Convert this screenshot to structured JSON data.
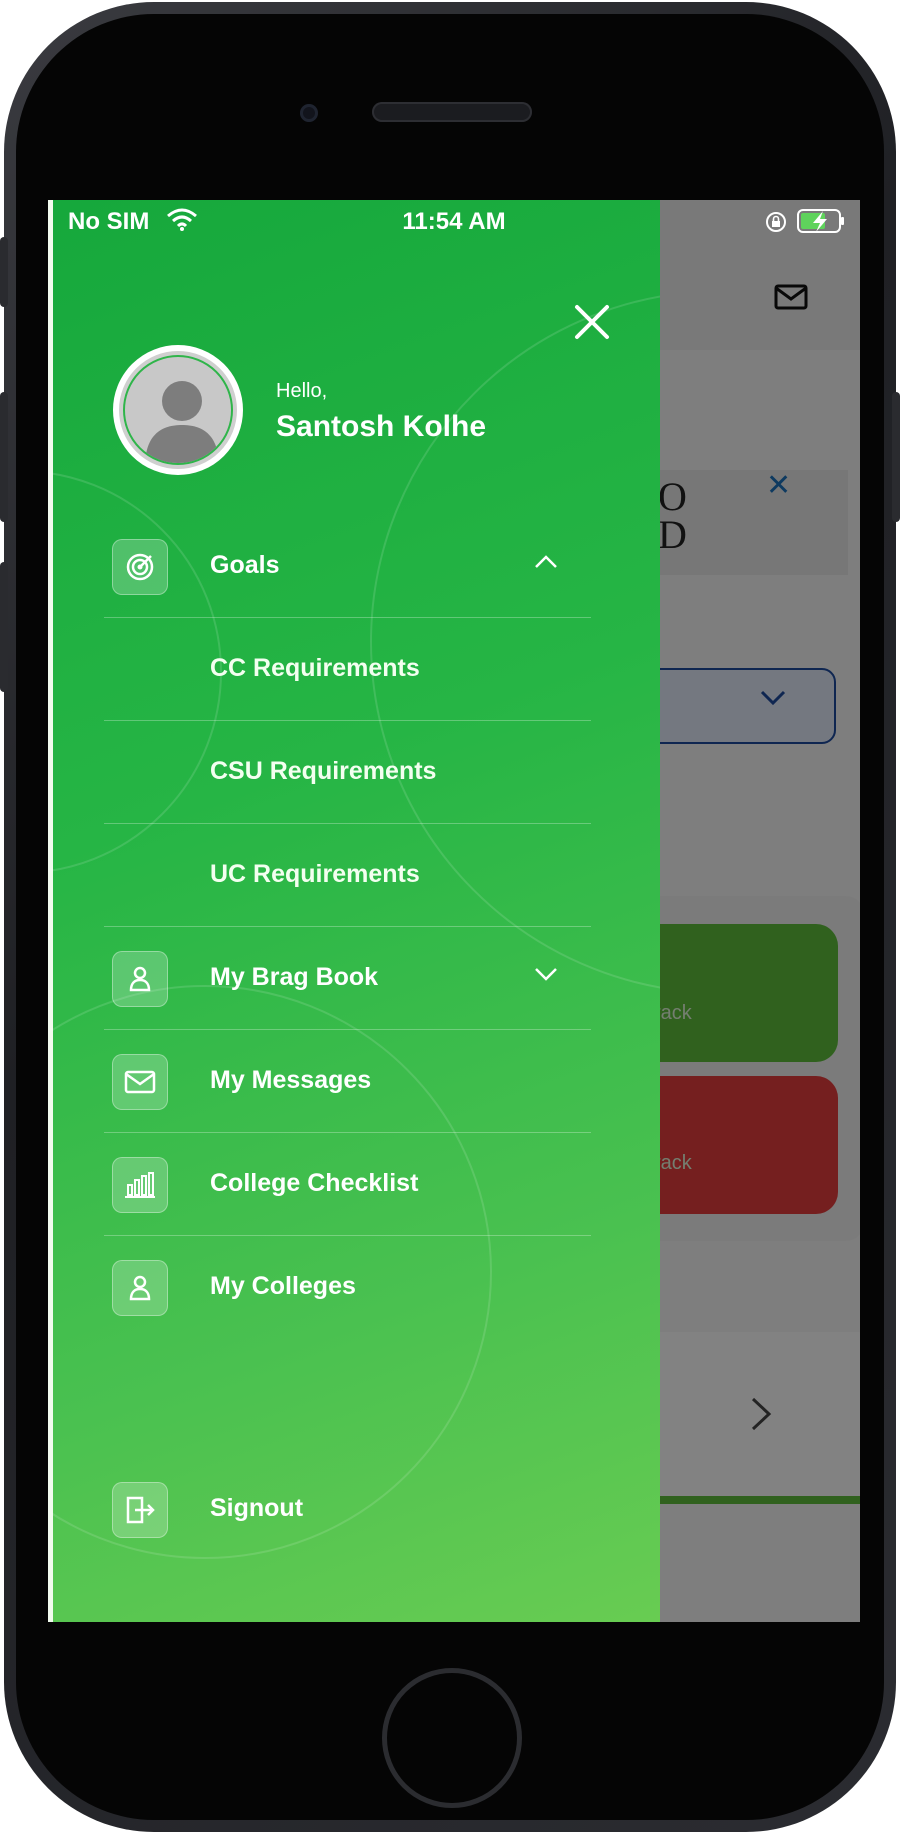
{
  "status_bar": {
    "carrier": "No SIM",
    "time": "11:54 AM"
  },
  "background_app": {
    "track_label_1": "rack",
    "track_label_2": "rack",
    "banner_text": "O\nD"
  },
  "drawer": {
    "greeting": "Hello,",
    "user_name": "Santosh Kolhe",
    "menu": [
      {
        "label": "Goals",
        "icon": "target-icon",
        "expanded": true
      },
      {
        "label": "CC Requirements",
        "submenu": true
      },
      {
        "label": "CSU Requirements",
        "submenu": true
      },
      {
        "label": "UC Requirements",
        "submenu": true
      },
      {
        "label": "My Brag Book",
        "icon": "person-icon",
        "expanded": false
      },
      {
        "label": "My Messages",
        "icon": "mail-icon"
      },
      {
        "label": "College Checklist",
        "icon": "bar-chart-icon"
      },
      {
        "label": "My Colleges",
        "icon": "person-icon"
      }
    ],
    "signout_label": "Signout"
  },
  "colors": {
    "drawer_start": "#16a83c",
    "drawer_end": "#68cc52",
    "accent_green": "#5cbb3a",
    "accent_red": "#e03c3c"
  }
}
